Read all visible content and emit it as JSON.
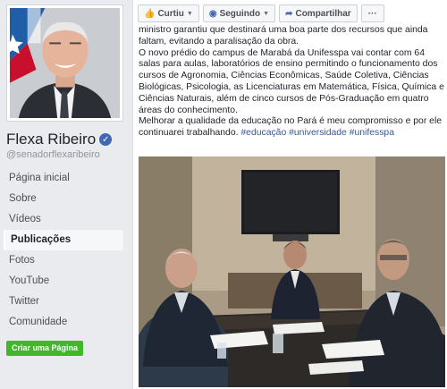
{
  "page": {
    "name": "Flexa Ribeiro",
    "username": "@senadorflexaribeiro",
    "verified_icon": "check-icon"
  },
  "sidebar": {
    "items": [
      {
        "label": "Página inicial"
      },
      {
        "label": "Sobre"
      },
      {
        "label": "Vídeos"
      },
      {
        "label": "Publicações"
      },
      {
        "label": "Fotos"
      },
      {
        "label": "YouTube"
      },
      {
        "label": "Twitter"
      },
      {
        "label": "Comunidade"
      }
    ],
    "active_index": 3,
    "create_page_label": "Criar uma Página"
  },
  "toolbar": {
    "like_label": "Curtiu",
    "following_label": "Seguindo",
    "share_label": "Compartilhar",
    "more_label": "···"
  },
  "post": {
    "line1": "ministro garantiu que destinará uma boa parte dos recursos que ainda faltam, evitando a paralisação da obra.",
    "line2": "O novo prédio do campus de Marabá da Unifesspa vai contar com 64 salas para aulas, laboratórios de ensino permitindo o funcionamento dos cursos de Agronomia, Ciências Econômicas, Saúde Coletiva, Ciências Biológicas, Psicologia, as Licenciaturas em Matemática, Física, Química e Ciências Naturais, além de cinco cursos de Pós-Graduação em quatro áreas do conhecimento.",
    "line3": "Melhorar a qualidade da educação no Pará é meu compromisso e por ele continuarei trabalhando.",
    "hashtags": [
      "#educação",
      "#universidade",
      "#unifesspa"
    ]
  },
  "colors": {
    "accent": "#4267b2",
    "link": "#365899",
    "create_button": "#42b72a",
    "background": "#e9ebee"
  }
}
